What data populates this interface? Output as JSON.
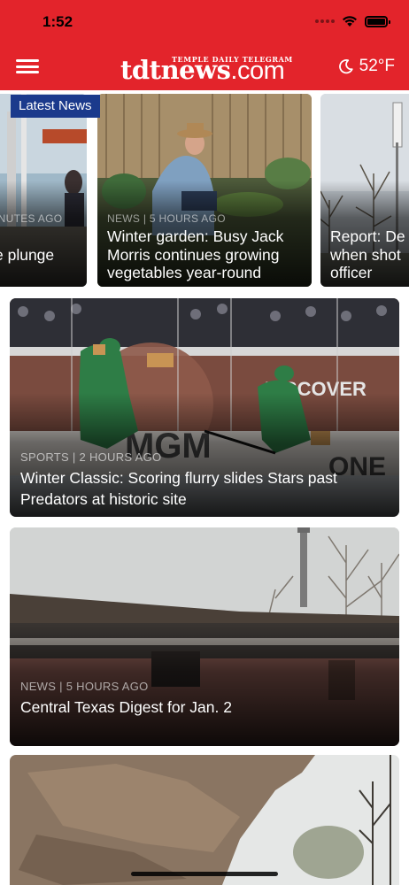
{
  "status_bar": {
    "time": "1:52"
  },
  "header": {
    "logo_tagline": "TEMPLE DAILY TELEGRAM",
    "logo_main": "tdtnews",
    "logo_dot": ".",
    "logo_com": "com",
    "temperature": "52°F"
  },
  "carousel": {
    "badge": "Latest News",
    "cards": [
      {
        "meta": "INUTES AGO",
        "title": "e plunge"
      },
      {
        "meta": "NEWS | 5 HOURS AGO",
        "title": "Winter garden: Busy Jack Morris continues growing vegetables year-round"
      },
      {
        "meta": "",
        "title": "Report: De when shot officer"
      }
    ]
  },
  "stories": [
    {
      "meta": "SPORTS | 2 HOURS AGO",
      "title": "Winter Classic: Scoring flurry slides Stars past Predators at historic site"
    },
    {
      "meta": "NEWS | 5 HOURS AGO",
      "title": "Central Texas Digest for Jan. 2"
    },
    {
      "meta": "",
      "title": ""
    }
  ],
  "icons": [
    "menu-icon",
    "moon-icon",
    "wifi-icon",
    "battery-icon",
    "cellular-icon"
  ]
}
